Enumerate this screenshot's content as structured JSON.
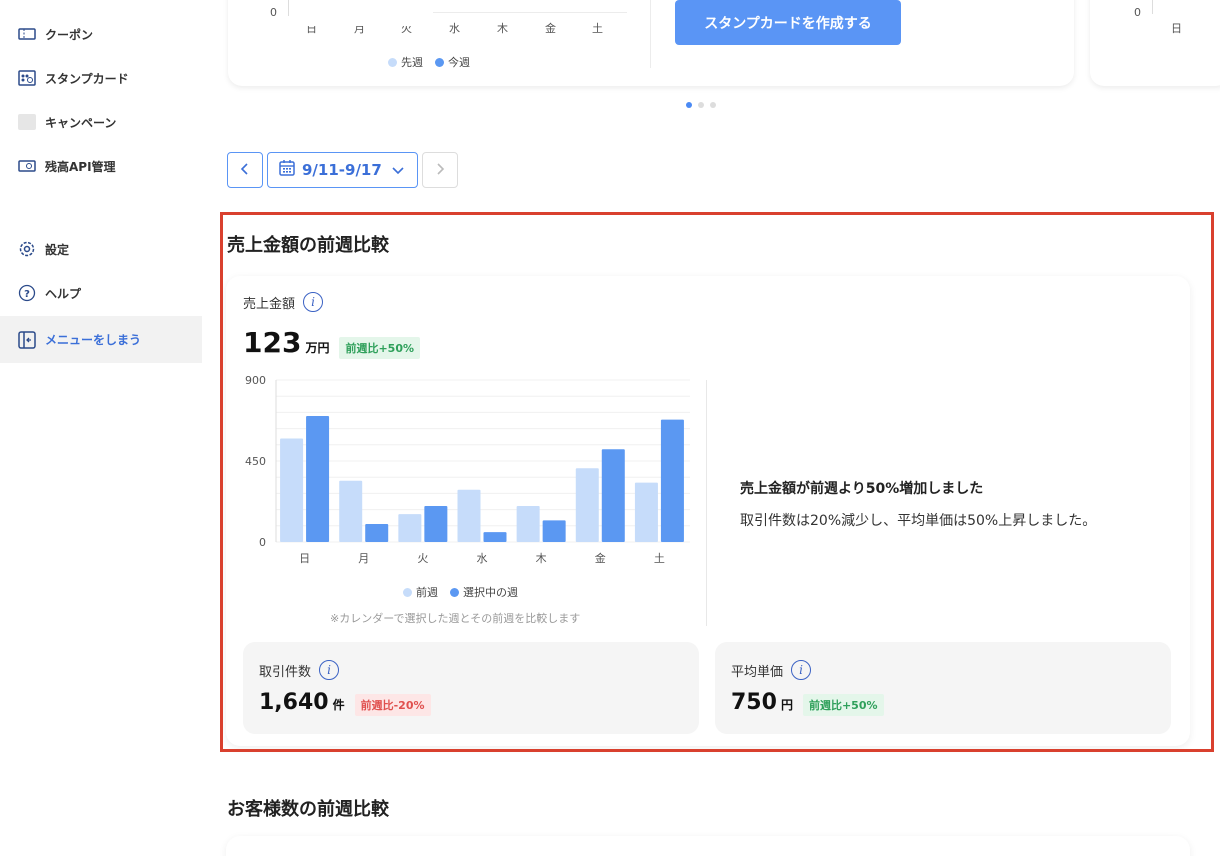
{
  "sidebar": {
    "items": [
      {
        "label": "クーポン",
        "icon": "coupon-icon"
      },
      {
        "label": "スタンプカード",
        "icon": "stamp-card-icon"
      },
      {
        "label": "キャンペーン",
        "icon": "campaign-icon"
      },
      {
        "label": "残高API管理",
        "icon": "balance-api-icon"
      },
      {
        "label": "設定",
        "icon": "gear-icon"
      },
      {
        "label": "ヘルプ",
        "icon": "help-icon"
      },
      {
        "label": "メニューをしまう",
        "icon": "collapse-menu-icon"
      }
    ]
  },
  "top_carousel": {
    "left_chart": {
      "y_tick": "0",
      "days": [
        "日",
        "月",
        "火",
        "水",
        "木",
        "金",
        "土"
      ],
      "legend": [
        "先週",
        "今週"
      ]
    },
    "create_button": "スタンプカードを作成する",
    "right_chart": {
      "y_tick": "0",
      "x_tick": "日"
    },
    "dots": 3,
    "active_dot": 0
  },
  "week_nav": {
    "range": "9/11-9/17",
    "prev_icon": "chevron-left-icon",
    "next_icon": "chevron-right-icon"
  },
  "sales_section": {
    "title": "売上金額の前週比較",
    "metric_label": "売上金額",
    "metric_value": "123",
    "metric_unit": "万円",
    "metric_badge": "前週比+50%",
    "summary_title": "売上金額が前週より50%増加しました",
    "summary_body": "取引件数は20%減少し、平均単価は50%上昇しました。",
    "note": "※カレンダーで選択した週とその前週を比較します",
    "transactions": {
      "label": "取引件数",
      "value": "1,640",
      "unit": "件",
      "badge": "前週比-20%"
    },
    "avg_price": {
      "label": "平均単価",
      "value": "750",
      "unit": "円",
      "badge": "前週比+50%"
    }
  },
  "customers_section": {
    "title": "お客様数の前週比較"
  },
  "colors": {
    "prev_week": "#c6dcfa",
    "this_week": "#5b98f2",
    "accent": "#3b6fd8",
    "highlight": "#d9402e"
  },
  "chart_data": {
    "type": "bar",
    "categories": [
      "日",
      "月",
      "火",
      "水",
      "木",
      "金",
      "土"
    ],
    "series": [
      {
        "name": "前週",
        "values": [
          575,
          340,
          155,
          290,
          200,
          410,
          330
        ]
      },
      {
        "name": "選択中の週",
        "values": [
          700,
          100,
          200,
          55,
          120,
          515,
          680
        ]
      }
    ],
    "yticks": [
      "900",
      "450",
      "0"
    ],
    "ylim": [
      0,
      900
    ],
    "grid": true,
    "legend": "bottom"
  }
}
